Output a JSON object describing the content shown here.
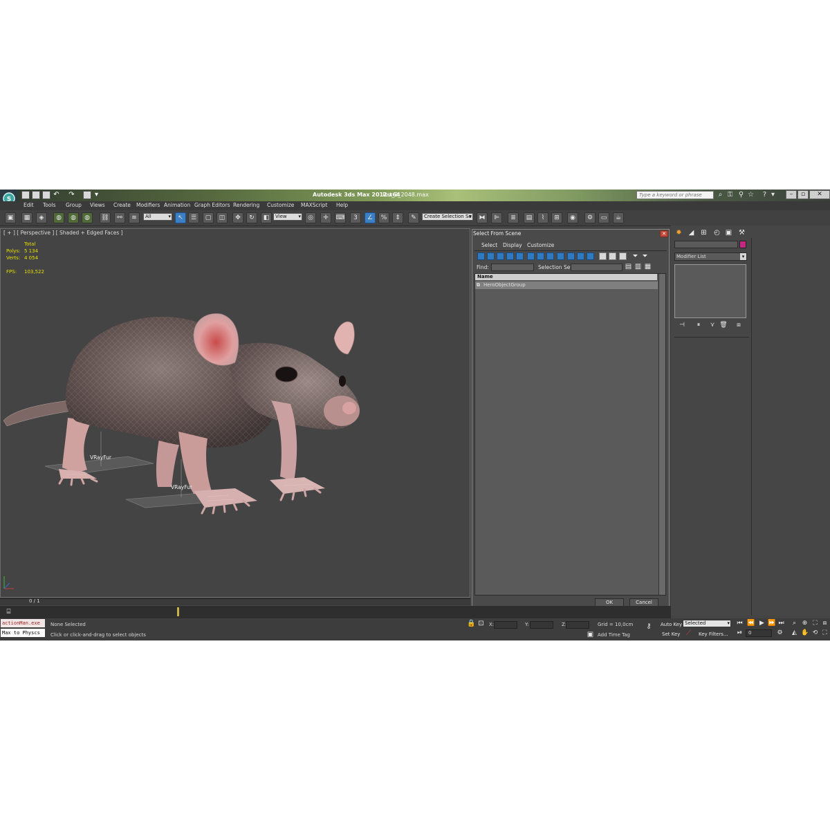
{
  "window": {
    "title": "Autodesk 3ds Max  2012 x64",
    "file": "Rat_2_2048.max",
    "search_placeholder": "Type a keyword or phrase"
  },
  "menu": [
    "Edit",
    "Tools",
    "Group",
    "Views",
    "Create",
    "Modifiers",
    "Animation",
    "Graph Editors",
    "Rendering",
    "Customize",
    "MAXScript",
    "Help"
  ],
  "toolbar": {
    "filter_value": "All",
    "coord_value": "View",
    "selection_set_placeholder": "Create Selection Se",
    "snap_label": "3",
    "percent_label": "%"
  },
  "viewport": {
    "label": "[ + ] [ Perspective ] [ Shaded + Edged Faces ]",
    "stats": {
      "total_label": "Total",
      "polys_label": "Polys:",
      "polys_value": "5 134",
      "verts_label": "Verts:",
      "verts_value": "4 054",
      "fps_label": "FPS:",
      "fps_value": "103,522"
    },
    "fur_labels": [
      "VRayFur",
      "VRayFur"
    ]
  },
  "dialog": {
    "title": "Select From Scene",
    "menu": [
      "Select",
      "Display",
      "Customize"
    ],
    "find_label": "Find:",
    "selection_set_label": "Selection Set:",
    "column_header": "Name",
    "items": [
      "HeroObjectGroup"
    ],
    "ok_label": "OK",
    "cancel_label": "Cancel"
  },
  "command_panel": {
    "modifier_list": "Modifier List"
  },
  "time_slider": {
    "label": "0 / 1"
  },
  "status": {
    "listener_lines": [
      "actionMan.exe",
      "Max to Physcs"
    ],
    "selection_status": "None Selected",
    "prompt": "Click or click-and-drag to select objects",
    "x_label": "X:",
    "y_label": "Y:",
    "z_label": "Z:",
    "grid": "Grid = 10,0cm",
    "add_time_tag": "Add Time Tag",
    "auto_key": "Auto Key",
    "set_key": "Set Key",
    "selected_value": "Selected",
    "key_filters": "Key Filters...",
    "frame_value": "0"
  },
  "colors": {
    "title_gradient_mid": "#a9c07a",
    "active_button": "#3d7fc4",
    "stats_text": "#e6e000",
    "object_color": "#c4277f"
  }
}
